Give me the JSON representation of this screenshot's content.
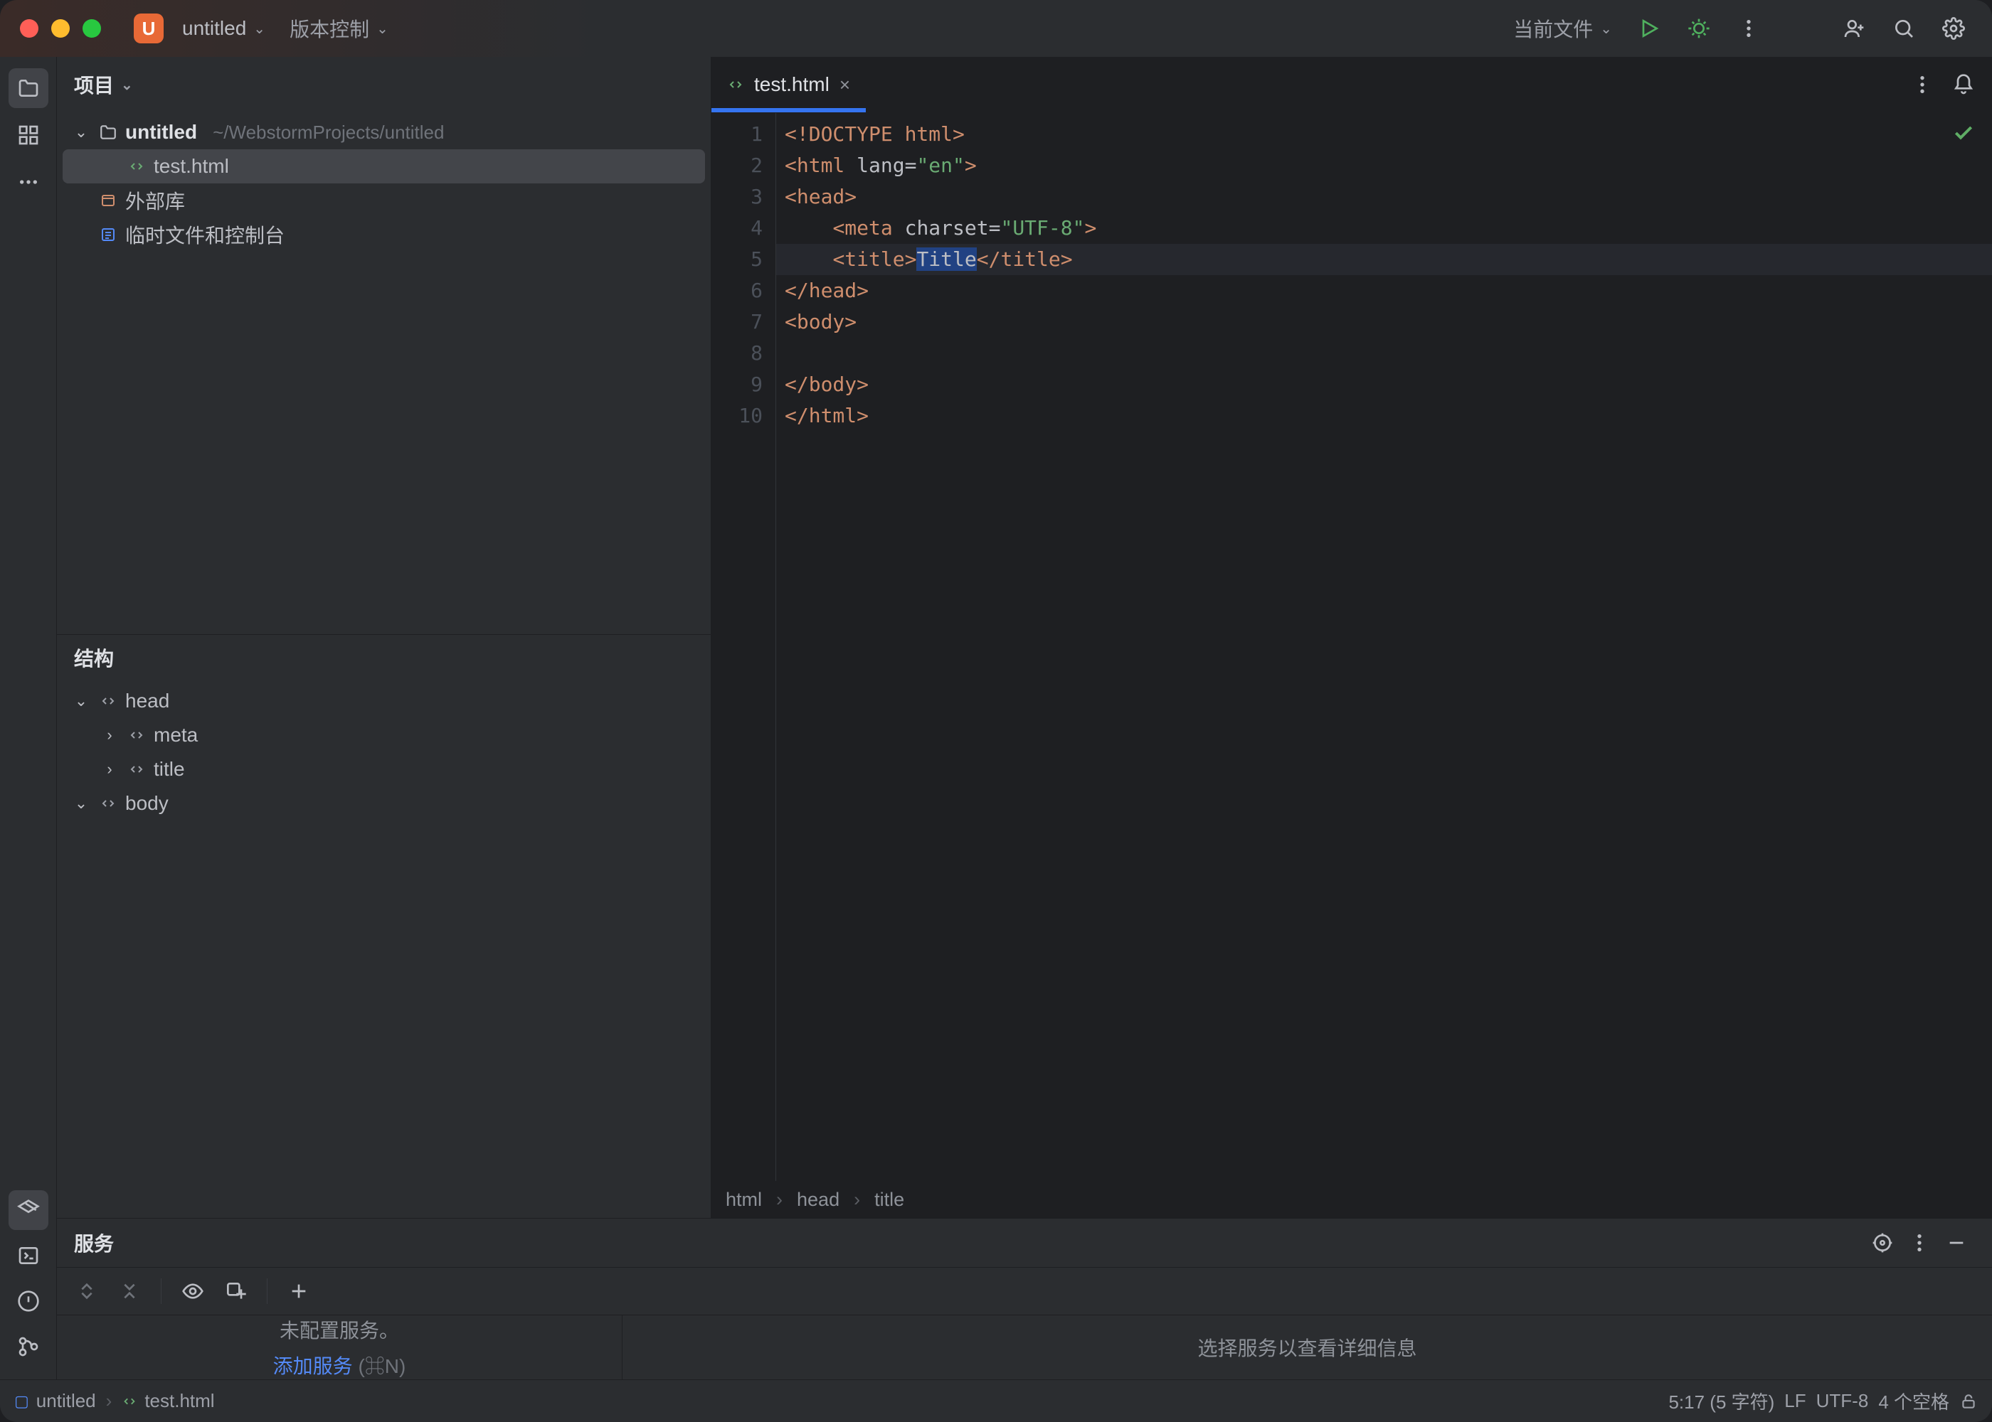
{
  "titlebar": {
    "project_badge": "U",
    "project_name": "untitled",
    "vcs_label": "版本控制",
    "run_config": "当前文件"
  },
  "sidebar": {
    "project_label": "项目",
    "root_name": "untitled",
    "root_path": "~/WebstormProjects/untitled",
    "file_name": "test.html",
    "external_libs": "外部库",
    "scratches": "临时文件和控制台"
  },
  "structure": {
    "label": "结构",
    "nodes": {
      "head": "head",
      "meta": "meta",
      "title": "title",
      "body": "body"
    }
  },
  "editor": {
    "tab_name": "test.html",
    "gutter": [
      "1",
      "2",
      "3",
      "4",
      "5",
      "6",
      "7",
      "8",
      "9",
      "10"
    ],
    "code": {
      "l1_a": "<!DOCTYPE ",
      "l1_b": "html",
      "l1_c": ">",
      "l2_a": "<html ",
      "l2_attr": "lang",
      "l2_eq": "=",
      "l2_str": "\"en\"",
      "l2_c": ">",
      "l3": "<head>",
      "l4_pad": "    ",
      "l4_a": "<meta ",
      "l4_attr": "charset",
      "l4_eq": "=",
      "l4_str": "\"UTF-8\"",
      "l4_c": ">",
      "l5_pad": "    ",
      "l5_a": "<title>",
      "l5_sel": "Title",
      "l5_c": "</title>",
      "l6": "</head>",
      "l7": "<body>",
      "l8": "",
      "l9": "</body>",
      "l10": "</html>"
    },
    "breadcrumb": {
      "a": "html",
      "b": "head",
      "c": "title"
    }
  },
  "services": {
    "label": "服务",
    "empty_msg": "未配置服务。",
    "add_link": "添加服务",
    "add_hint": "(⌘N)",
    "detail_msg": "选择服务以查看详细信息"
  },
  "statusbar": {
    "nav_project": "untitled",
    "nav_file": "test.html",
    "caret": "5:17 (5 字符)",
    "lineend": "LF",
    "encoding": "UTF-8",
    "indent": "4 个空格"
  }
}
